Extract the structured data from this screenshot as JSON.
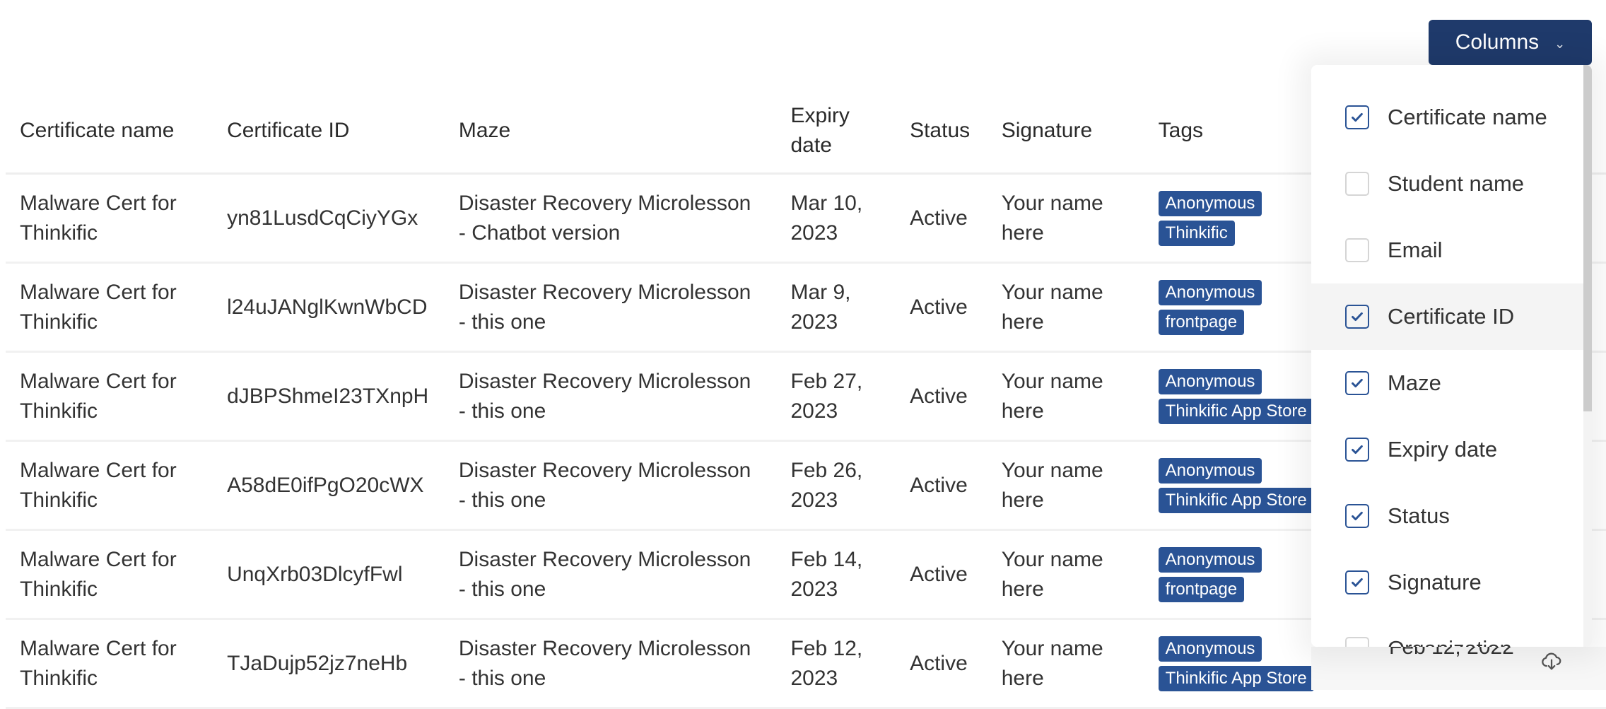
{
  "toolbar": {
    "columns_label": "Columns"
  },
  "table": {
    "headers": {
      "certificate_name": "Certificate name",
      "certificate_id": "Certificate ID",
      "maze": "Maze",
      "expiry_date": "Expiry date",
      "status": "Status",
      "signature": "Signature",
      "tags": "Tags"
    },
    "rows": [
      {
        "name": "Malware Cert for Thinkific",
        "id": "yn81LusdCqCiyYGx",
        "maze": "Disaster Recovery Microlesson - Chatbot version",
        "expiry": "Mar 10, 2023",
        "status": "Active",
        "signature": "Your name here",
        "tags": [
          "Anonymous",
          "Thinkific"
        ]
      },
      {
        "name": "Malware Cert for Thinkific",
        "id": "l24uJANglKwnWbCD",
        "maze": "Disaster Recovery Microlesson - this one",
        "expiry": "Mar 9, 2023",
        "status": "Active",
        "signature": "Your name here",
        "tags": [
          "Anonymous",
          "frontpage"
        ]
      },
      {
        "name": "Malware Cert for Thinkific",
        "id": "dJBPShmeI23TXnpH",
        "maze": "Disaster Recovery Microlesson - this one",
        "expiry": "Feb 27, 2023",
        "status": "Active",
        "signature": "Your name here",
        "tags": [
          "Anonymous",
          "Thinkific App Store"
        ]
      },
      {
        "name": "Malware Cert for Thinkific",
        "id": "A58dE0ifPgO20cWX",
        "maze": "Disaster Recovery Microlesson - this one",
        "expiry": "Feb 26, 2023",
        "status": "Active",
        "signature": "Your name here",
        "tags": [
          "Anonymous",
          "Thinkific App Store"
        ]
      },
      {
        "name": "Malware Cert for Thinkific",
        "id": "UnqXrb03DlcyfFwl",
        "maze": "Disaster Recovery Microlesson - this one",
        "expiry": "Feb 14, 2023",
        "status": "Active",
        "signature": "Your name here",
        "tags": [
          "Anonymous",
          "frontpage"
        ]
      },
      {
        "name": "Malware Cert for Thinkific",
        "id": "TJaDujp52jz7neHb",
        "maze": "Disaster Recovery Microlesson - this one",
        "expiry": "Feb 12, 2023",
        "status": "Active",
        "signature": "Your name here",
        "tags": [
          "Anonymous",
          "Thinkific App Store"
        ]
      }
    ],
    "partial_last_row_date": "Feb 12, 2022",
    "download_icon": "cloud-download-icon"
  },
  "columns_menu": {
    "items": [
      {
        "label": "Certificate name",
        "checked": true
      },
      {
        "label": "Student name",
        "checked": false
      },
      {
        "label": "Email",
        "checked": false
      },
      {
        "label": "Certificate ID",
        "checked": true,
        "hovered": true
      },
      {
        "label": "Maze",
        "checked": true
      },
      {
        "label": "Expiry date",
        "checked": true
      },
      {
        "label": "Status",
        "checked": true
      },
      {
        "label": "Signature",
        "checked": true
      },
      {
        "label": "Organization",
        "checked": false
      }
    ]
  },
  "colors": {
    "primary": "#1f3a6b",
    "tag": "#2a5395",
    "checkbox": "#2a5395"
  }
}
